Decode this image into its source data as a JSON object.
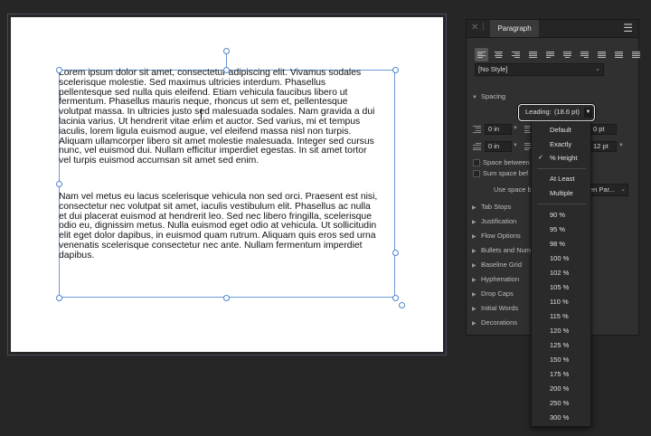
{
  "document": {
    "paragraph1": "Lorem ipsum dolor sit amet, consectetur adipiscing elit. Vivamus sodales\nscelerisque molestie. Sed maximus ultricies interdum. Phasellus\npellentesque sed nulla quis eleifend. Etiam vehicula faucibus libero ut\nfermentum. Phasellus mauris neque, rhoncus ut sem et, pellentesque\nvolutpat massa. In ultricies justo sed malesuada sodales. Nam gravida a dui\nlacinia varius. Ut hendrerit vitae enim et auctor. Sed varius, mi et tempus\niaculis, lorem ligula euismod augue, vel eleifend massa nisl non turpis.\nAliquam ullamcorper libero sit amet molestie malesuada. Integer sed cursus\nnunc, vel euismod dui. Nullam efficitur imperdiet egestas. In sit amet tortor\nvel turpis euismod accumsan sit amet sed enim.",
    "paragraph2": "Nam vel metus eu lacus scelerisque vehicula non sed orci. Praesent est nisi,\nconsectetur nec volutpat sit amet, iaculis vestibulum elit. Phasellus ac nulla\net dui placerat euismod at hendrerit leo. Sed nec libero fringilla, scelerisque\nodio eu, dignissim metus. Nulla euismod eget odio at vehicula. Ut sollicitudin\nelit eget dolor dapibus, in euismod quam rutrum. Aliquam quis eros sed urna\nvenenatis scelerisque consectetur nec ante. Nullam fermentum imperdiet\ndapibus."
  },
  "panel": {
    "title": "Paragraph",
    "menu_icon": "☰",
    "close_icon": "✕",
    "grip_icon": "⁞",
    "style_select": "[No Style]",
    "spacing_section": "Spacing",
    "leading_label": "Leading:",
    "leading_value": "(18.6 pt)",
    "field_left_indent": "0 in",
    "field_first_indent": "0 in",
    "field_space_before": "0 pt",
    "field_space_after": "12 pt",
    "space_between_label": "Space between",
    "sum_space_label": "Sum space bef",
    "use_space_label": "Use space b",
    "use_space_value": "en Par...",
    "collapsed_sections": [
      "Tab Stops",
      "Justification",
      "Flow Options",
      "Bullets and Num",
      "Baseline Grid",
      "Hyphenation",
      "Drop Caps",
      "Initial Words",
      "Decorations"
    ]
  },
  "leading_menu": {
    "items_top": [
      "Default",
      "Exactly",
      "% Height"
    ],
    "checked": "% Height",
    "items_mid": [
      "At Least",
      "Multiple"
    ],
    "percentages": [
      "90 %",
      "95 %",
      "98 %",
      "100 %",
      "102 %",
      "105 %",
      "110 %",
      "115 %",
      "120 %",
      "125 %",
      "150 %",
      "175 %",
      "200 %",
      "250 %",
      "300 %"
    ]
  },
  "colors": {
    "background": "#262626",
    "panel": "#303030",
    "selection": "#6b9ad6",
    "page": "#ffffff"
  }
}
